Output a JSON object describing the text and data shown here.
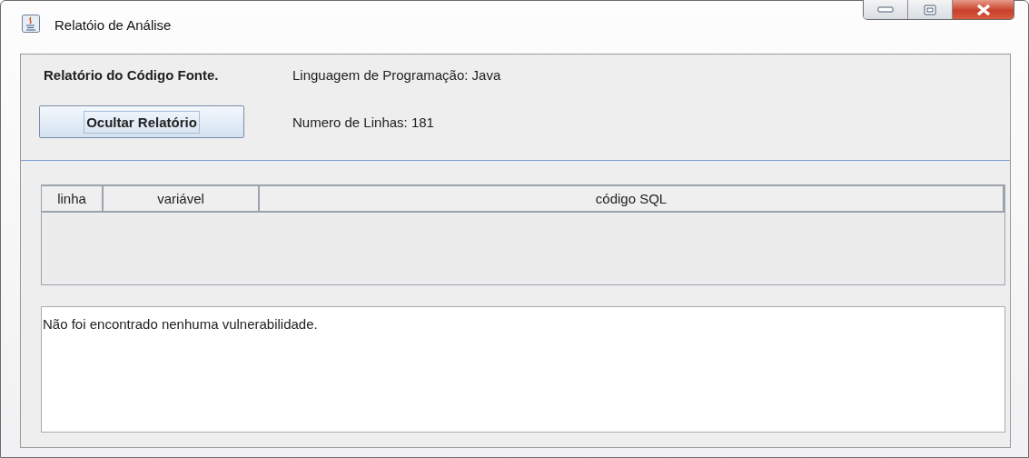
{
  "window": {
    "title": "Relatóio de Análise"
  },
  "header": {
    "report_title": "Relatório do Código Fonte.",
    "language": "Linguagem de Programação: Java",
    "line_count": "Numero de Linhas: 181"
  },
  "buttons": [
    {
      "label": "Ocultar Relatório"
    }
  ],
  "table": {
    "columns": [
      {
        "label": "linha"
      },
      {
        "label": "variável"
      },
      {
        "label": "código SQL"
      }
    ]
  },
  "message": {
    "value": "Não foi encontrado nenhuma vulnerabilidade."
  }
}
